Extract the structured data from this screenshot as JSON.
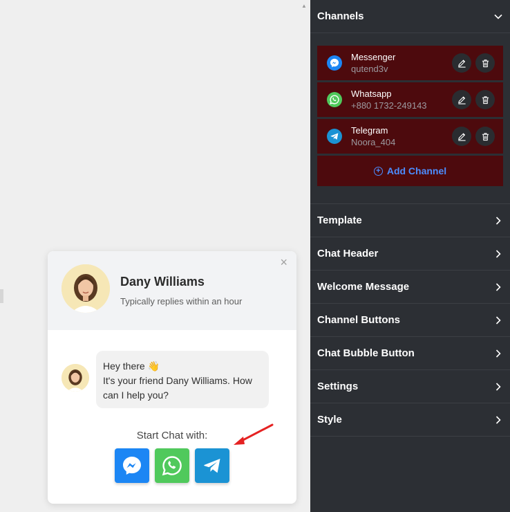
{
  "preview": {
    "agent_name": "Dany Williams",
    "agent_status": "Typically replies within an hour",
    "close_symbol": "×",
    "message_line1": "Hey there",
    "message_emoji": "👋",
    "message_line2": "It's your friend Dany Williams. How can I help you?",
    "start_chat_label": "Start Chat with:",
    "buttons": [
      {
        "name": "messenger",
        "color": "#1c86f4",
        "icon": "messenger-icon"
      },
      {
        "name": "whatsapp",
        "color": "#50c95c",
        "icon": "whatsapp-icon"
      },
      {
        "name": "telegram",
        "color": "#1b93d4",
        "icon": "telegram-icon"
      }
    ]
  },
  "panel": {
    "channels_title": "Channels",
    "channels": [
      {
        "name": "Messenger",
        "value": "qutend3v",
        "icon": "messenger-icon",
        "color": "#1c86f4"
      },
      {
        "name": "Whatsapp",
        "value": "+880 1732-249143",
        "icon": "whatsapp-icon",
        "color": "#50c95c"
      },
      {
        "name": "Telegram",
        "value": "Noora_404",
        "icon": "telegram-icon",
        "color": "#1b93d4"
      }
    ],
    "add_channel_label": "Add Channel",
    "sections": [
      "Template",
      "Chat Header",
      "Welcome Message",
      "Channel Buttons",
      "Chat Bubble Button",
      "Settings",
      "Style"
    ]
  },
  "colors": {
    "panel_bg": "#2c2f34",
    "channel_row_bg": "#4d0a0d",
    "accent_link": "#4c8dff",
    "arrow": "#e52222"
  }
}
